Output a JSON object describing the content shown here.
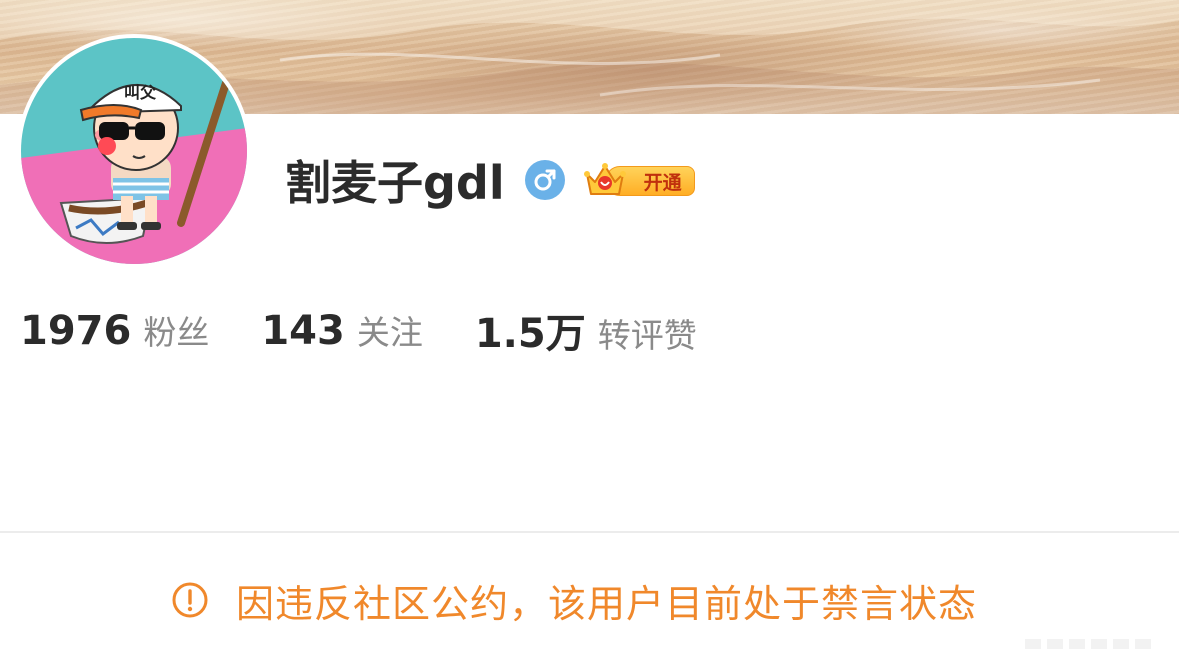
{
  "profile": {
    "username": "割麦子gdl",
    "gender_icon": "male-symbol-icon",
    "vip_badge_label": "开通",
    "avatar_cap_text": "叫父"
  },
  "stats": [
    {
      "value": "1976",
      "label": "粉丝"
    },
    {
      "value": "143",
      "label": "关注"
    },
    {
      "value": "1.5万",
      "label": "转评赞"
    }
  ],
  "notice": {
    "icon": "exclamation-circle-icon",
    "text": "因违反社区公约，该用户目前处于禁言状态"
  },
  "colors": {
    "notice": "#f0882b",
    "gender": "#6ab1e8",
    "vip": "#ffae25",
    "text_primary": "#2b2b2b",
    "text_secondary": "#8a8a8a"
  }
}
